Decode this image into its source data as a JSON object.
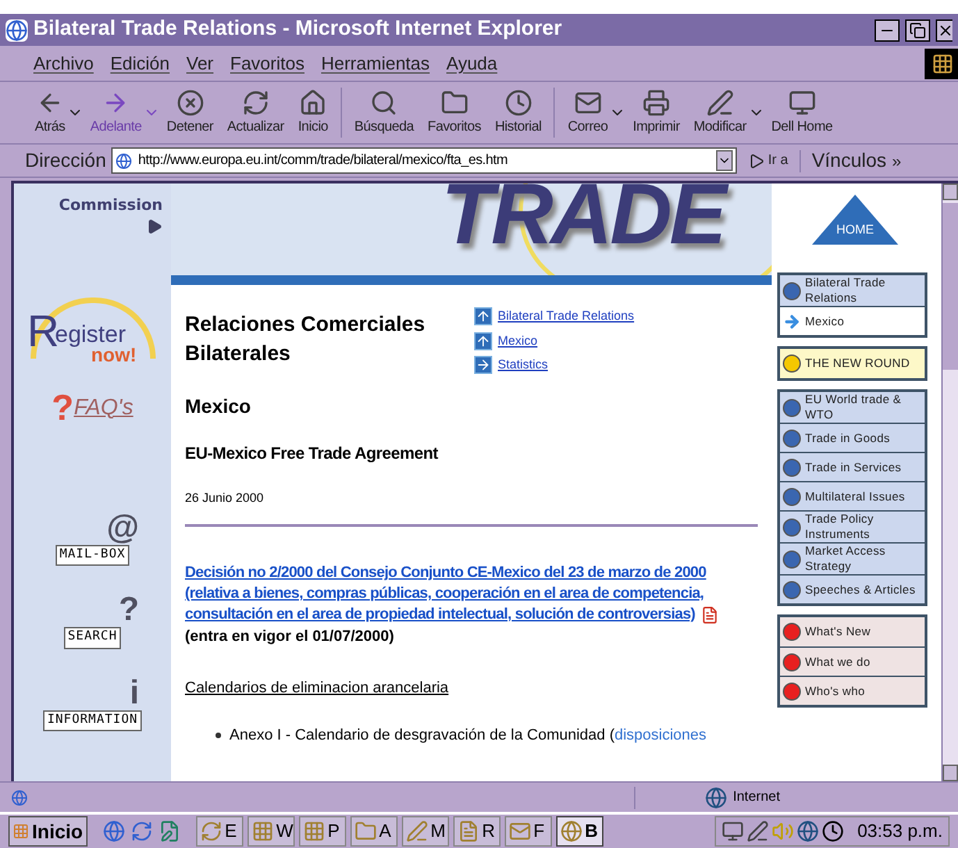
{
  "window": {
    "title": "Bilateral Trade Relations - Microsoft Internet Explorer"
  },
  "menu": [
    "Archivo",
    "Edición",
    "Ver",
    "Favoritos",
    "Herramientas",
    "Ayuda"
  ],
  "toolbar": [
    {
      "label": "Atrás",
      "kind": "back",
      "disabled": false,
      "dropdown": true
    },
    {
      "label": "Adelante",
      "kind": "forward",
      "disabled": true,
      "dropdown": true
    },
    {
      "label": "Detener",
      "kind": "stop",
      "disabled": false,
      "dropdown": false
    },
    {
      "label": "Actualizar",
      "kind": "refresh",
      "disabled": false,
      "dropdown": false
    },
    {
      "label": "Inicio",
      "kind": "home",
      "disabled": false,
      "dropdown": false
    },
    {
      "label": "Búsqueda",
      "kind": "search",
      "disabled": false,
      "dropdown": false
    },
    {
      "label": "Favoritos",
      "kind": "favorites",
      "disabled": false,
      "dropdown": false
    },
    {
      "label": "Historial",
      "kind": "history",
      "disabled": false,
      "dropdown": false
    },
    {
      "label": "Correo",
      "kind": "mail",
      "disabled": false,
      "dropdown": true
    },
    {
      "label": "Imprimir",
      "kind": "print",
      "disabled": false,
      "dropdown": false
    },
    {
      "label": "Modificar",
      "kind": "edit",
      "disabled": false,
      "dropdown": true
    },
    {
      "label": "Dell Home",
      "kind": "dell",
      "disabled": false,
      "dropdown": false
    }
  ],
  "address": {
    "label": "Dirección",
    "value": "http://www.europa.eu.int/comm/trade/bilateral/mexico/fta_es.htm",
    "go": "Ir a",
    "links": "Vínculos",
    "more": "»"
  },
  "left_sidebar": {
    "commission": "Commission",
    "register": {
      "initial": "R",
      "word": "egister",
      "now": "now!"
    },
    "faq": {
      "mark": "?",
      "label": "FAQ's"
    },
    "tools": [
      {
        "glyph": "@",
        "label": "MAIL-BOX"
      },
      {
        "glyph": "?",
        "label": "SEARCH"
      },
      {
        "glyph": "i",
        "label": "INFORMATION"
      }
    ]
  },
  "banner": {
    "logo": "TRADE",
    "home": "HOME"
  },
  "content": {
    "title": "Relaciones Comerciales Bilaterales",
    "links": [
      {
        "label": "Bilateral Trade Relations",
        "kind": "up"
      },
      {
        "label": "Mexico",
        "kind": "up"
      },
      {
        "label": "Statistics",
        "kind": "right"
      }
    ],
    "country": "Mexico",
    "subtitle": "EU-Mexico Free Trade Agreement",
    "date": "26 Junio 2000",
    "decision_link": "Decisión no 2/2000 del Consejo Conjunto CE-Mexico del 23 de marzo de 2000 (relativa a bienes, compras públicas, cooperación en el area de competencia, consultación en el area de propiedad intelectual, solución de controversias)",
    "decision_note": "(entra en vigor el 01/07/2000)",
    "calendars": "Calendarios de eliminacion arancelaria",
    "bullet": {
      "text": "Anexo I - Calendario de desgravación de la Comunidad (",
      "link": "disposiciones"
    }
  },
  "nav_groups": [
    {
      "items": [
        {
          "label": "Bilateral Trade Relations",
          "kind": "dot",
          "color": "#3a66b0"
        },
        {
          "label": "Mexico",
          "kind": "current",
          "color": "#3a8ee0"
        }
      ]
    },
    {
      "items": [
        {
          "label": "THE NEW ROUND",
          "kind": "dot",
          "color": "#f5c800"
        }
      ]
    },
    {
      "items": [
        {
          "label": "EU World trade & WTO",
          "kind": "dot",
          "color": "#3a66b0"
        },
        {
          "label": "Trade in Goods",
          "kind": "dot",
          "color": "#3a66b0"
        },
        {
          "label": "Trade in Services",
          "kind": "dot",
          "color": "#3a66b0"
        },
        {
          "label": "Multilateral Issues",
          "kind": "dot",
          "color": "#3a66b0"
        },
        {
          "label": "Trade Policy Instruments",
          "kind": "dot",
          "color": "#3a66b0"
        },
        {
          "label": "Market Access Strategy",
          "kind": "dot",
          "color": "#3a66b0"
        },
        {
          "label": "Speeches & Articles",
          "kind": "dot",
          "color": "#3a66b0"
        }
      ]
    },
    {
      "items": [
        {
          "label": "What's New",
          "kind": "dot",
          "color": "#e82020"
        },
        {
          "label": "What we do",
          "kind": "dot",
          "color": "#e82020"
        },
        {
          "label": "Who's who",
          "kind": "dot",
          "color": "#e82020"
        }
      ]
    }
  ],
  "status_bar": {
    "zone": "Internet"
  },
  "taskbar": {
    "start": "Inicio",
    "tasks": [
      {
        "label": "E",
        "selected": false
      },
      {
        "label": "W",
        "selected": false
      },
      {
        "label": "P",
        "selected": false
      },
      {
        "label": "A",
        "selected": false
      },
      {
        "label": "M",
        "selected": false
      },
      {
        "label": "R",
        "selected": false
      },
      {
        "label": "F",
        "selected": false
      },
      {
        "label": "B",
        "selected": true
      }
    ],
    "clock": "03:53 p.m."
  }
}
